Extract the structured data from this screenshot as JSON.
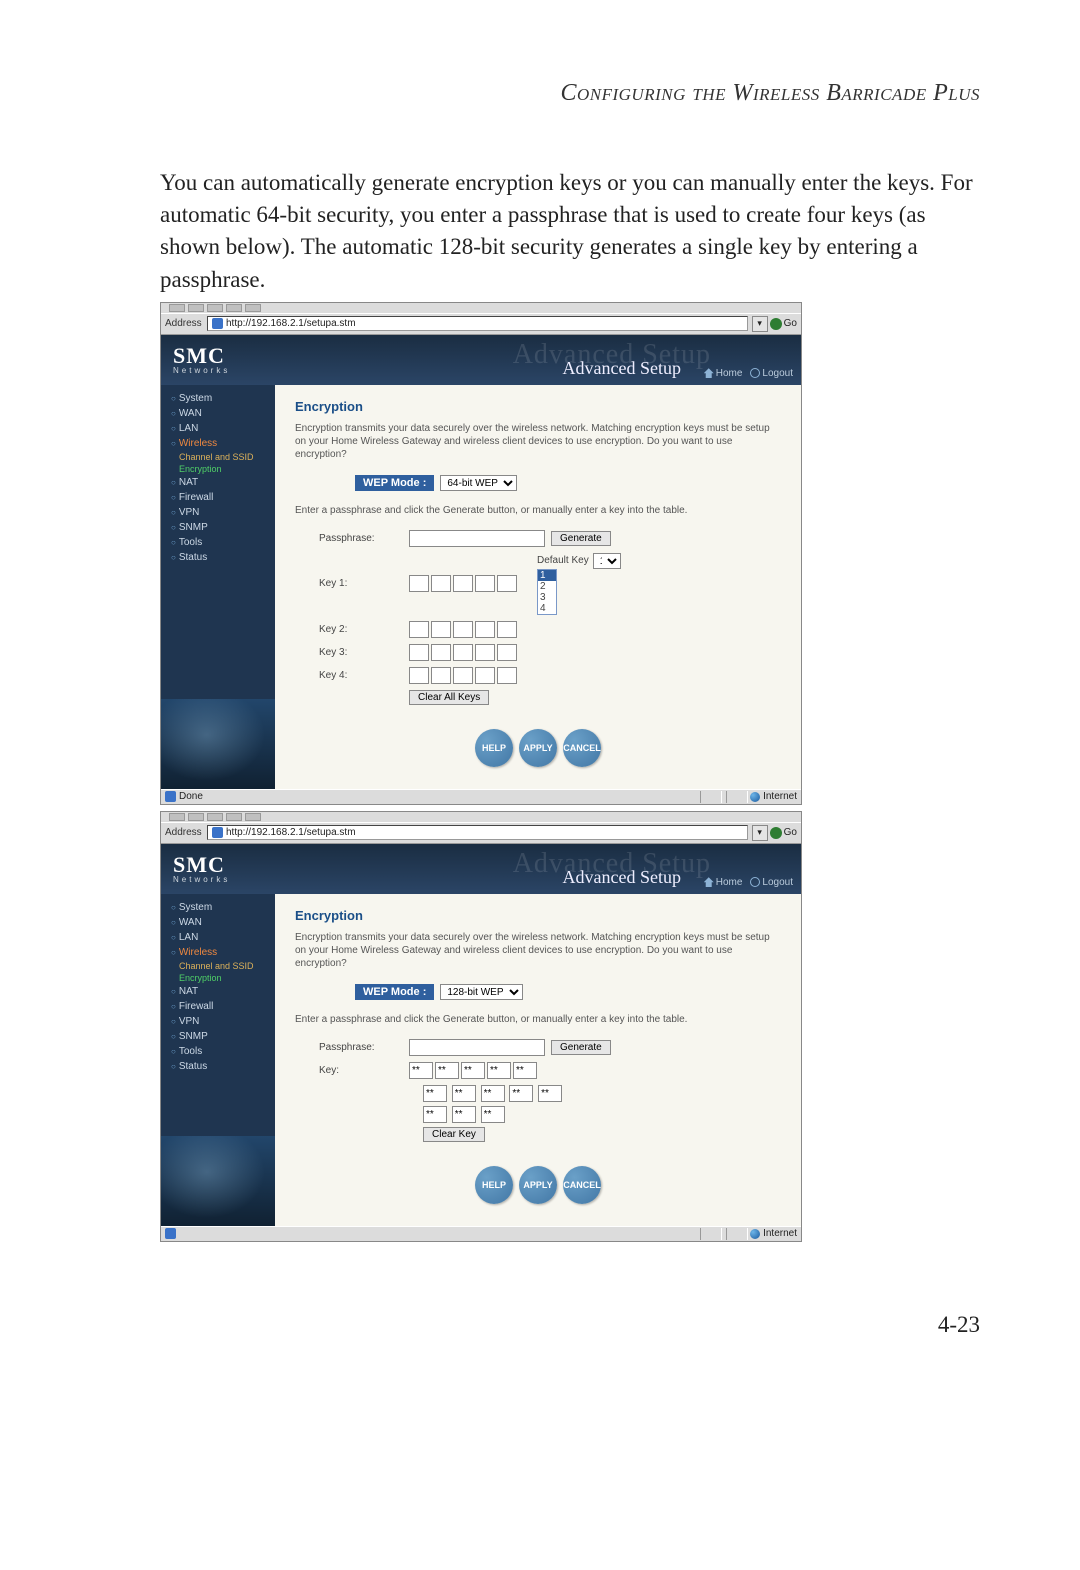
{
  "chapter_heading": "Configuring the Wireless Barricade Plus",
  "body_paragraph": "You can automatically generate encryption keys or you can manually enter the keys. For automatic 64-bit security, you enter a passphrase that is used to create four keys (as shown below). The automatic 128-bit security generates a single key by entering a passphrase.",
  "page_number": "4-23",
  "shot_a": {
    "address_label": "Address",
    "address_value": "http://192.168.2.1/setupa.stm",
    "go_label": "Go",
    "logo_main": "SMC",
    "logo_sub": "Networks",
    "header_bg_text": "Advanced Setup",
    "header_fg_text": "Advanced Setup",
    "home_label": "Home",
    "logout_label": "Logout",
    "sidebar": {
      "items": [
        "System",
        "WAN",
        "LAN",
        "Wireless",
        "NAT",
        "Firewall",
        "VPN",
        "SNMP",
        "Tools",
        "Status"
      ],
      "wireless_sub": [
        "Channel and SSID",
        "Encryption"
      ]
    },
    "content": {
      "heading": "Encryption",
      "description": "Encryption transmits your data securely over the wireless network. Matching encryption keys must be setup on your Home Wireless Gateway and wireless client devices to use encryption. Do you want to use encryption?",
      "wep_mode_label": "WEP Mode :",
      "wep_mode_value": "64-bit WEP",
      "instruction": "Enter a passphrase and click the Generate button, or manually enter a key into the table.",
      "passphrase_label": "Passphrase:",
      "generate_btn": "Generate",
      "key_labels": [
        "Key 1:",
        "Key 2:",
        "Key 3:",
        "Key 4:"
      ],
      "default_key_label": "Default Key",
      "default_key_value": "1",
      "default_key_options": [
        "1",
        "2",
        "3",
        "4"
      ],
      "clear_btn": "Clear All Keys",
      "action_help": "HELP",
      "action_apply": "APPLY",
      "action_cancel": "CANCEL"
    },
    "status_done": "Done",
    "status_zone": "Internet"
  },
  "shot_b": {
    "address_label": "Address",
    "address_value": "http://192.168.2.1/setupa.stm",
    "go_label": "Go",
    "logo_main": "SMC",
    "logo_sub": "Networks",
    "header_bg_text": "Advanced Setup",
    "header_fg_text": "Advanced Setup",
    "home_label": "Home",
    "logout_label": "Logout",
    "sidebar": {
      "items": [
        "System",
        "WAN",
        "LAN",
        "Wireless",
        "NAT",
        "Firewall",
        "VPN",
        "SNMP",
        "Tools",
        "Status"
      ],
      "wireless_sub": [
        "Channel and SSID",
        "Encryption"
      ]
    },
    "content": {
      "heading": "Encryption",
      "description": "Encryption transmits your data securely over the wireless network. Matching encryption keys must be setup on your Home Wireless Gateway and wireless client devices to use encryption. Do you want to use encryption?",
      "wep_mode_label": "WEP Mode :",
      "wep_mode_value": "128-bit WEP",
      "instruction": "Enter a passphrase and click the Generate button, or manually enter a key into the table.",
      "passphrase_label": "Passphrase:",
      "generate_btn": "Generate",
      "key_label": "Key:",
      "key_prefill": "**",
      "clear_btn": "Clear Key",
      "action_help": "HELP",
      "action_apply": "APPLY",
      "action_cancel": "CANCEL"
    },
    "status_done": "",
    "status_zone": "Internet"
  }
}
